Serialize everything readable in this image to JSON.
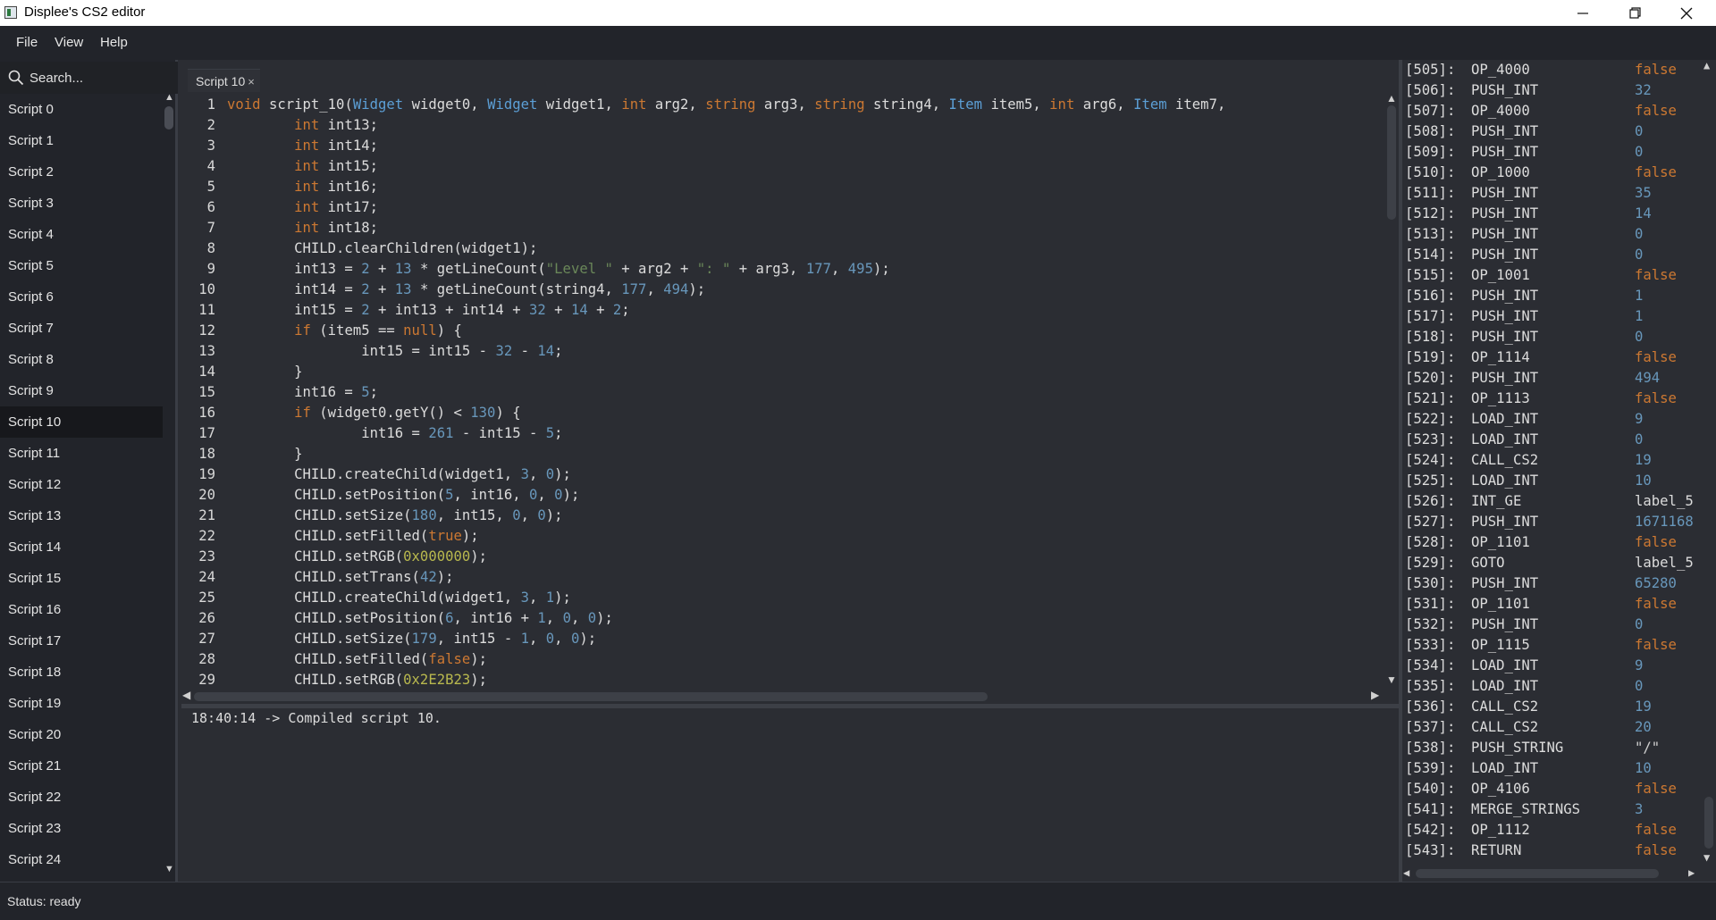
{
  "window": {
    "title": "Displee's CS2 editor"
  },
  "menu": {
    "file": "File",
    "view": "View",
    "help": "Help"
  },
  "sidebar": {
    "search_placeholder": "Search...",
    "active_index": 10,
    "items": [
      "Script 0",
      "Script 1",
      "Script 2",
      "Script 3",
      "Script 4",
      "Script 5",
      "Script 6",
      "Script 7",
      "Script 8",
      "Script 9",
      "Script 10",
      "Script 11",
      "Script 12",
      "Script 13",
      "Script 14",
      "Script 15",
      "Script 16",
      "Script 17",
      "Script 18",
      "Script 19",
      "Script 20",
      "Script 21",
      "Script 22",
      "Script 23",
      "Script 24"
    ]
  },
  "editor": {
    "tab_label": "Script 10",
    "tab_close": "×",
    "lines": [
      [
        [
          "kw",
          "void"
        ],
        [
          "t",
          " script_10("
        ],
        [
          "ty",
          "Widget"
        ],
        [
          "t",
          " widget0, "
        ],
        [
          "ty",
          "Widget"
        ],
        [
          "t",
          " widget1, "
        ],
        [
          "kw",
          "int"
        ],
        [
          "t",
          " arg2, "
        ],
        [
          "kw",
          "string"
        ],
        [
          "t",
          " arg3, "
        ],
        [
          "kw",
          "string"
        ],
        [
          "t",
          " string4, "
        ],
        [
          "ty",
          "Item"
        ],
        [
          "t",
          " item5, "
        ],
        [
          "kw",
          "int"
        ],
        [
          "t",
          " arg6, "
        ],
        [
          "ty",
          "Item"
        ],
        [
          "t",
          " item7,"
        ]
      ],
      [
        [
          "t",
          "        "
        ],
        [
          "kw",
          "int"
        ],
        [
          "t",
          " int13;"
        ]
      ],
      [
        [
          "t",
          "        "
        ],
        [
          "kw",
          "int"
        ],
        [
          "t",
          " int14;"
        ]
      ],
      [
        [
          "t",
          "        "
        ],
        [
          "kw",
          "int"
        ],
        [
          "t",
          " int15;"
        ]
      ],
      [
        [
          "t",
          "        "
        ],
        [
          "kw",
          "int"
        ],
        [
          "t",
          " int16;"
        ]
      ],
      [
        [
          "t",
          "        "
        ],
        [
          "kw",
          "int"
        ],
        [
          "t",
          " int17;"
        ]
      ],
      [
        [
          "t",
          "        "
        ],
        [
          "kw",
          "int"
        ],
        [
          "t",
          " int18;"
        ]
      ],
      [
        [
          "t",
          "        CHILD.clearChildren(widget1);"
        ]
      ],
      [
        [
          "t",
          "        int13 = "
        ],
        [
          "num",
          "2"
        ],
        [
          "t",
          " + "
        ],
        [
          "num",
          "13"
        ],
        [
          "t",
          " * getLineCount("
        ],
        [
          "str",
          "\"Level \""
        ],
        [
          "t",
          " + arg2 + "
        ],
        [
          "str",
          "\": \""
        ],
        [
          "t",
          " + arg3, "
        ],
        [
          "num",
          "177"
        ],
        [
          "t",
          ", "
        ],
        [
          "num",
          "495"
        ],
        [
          "t",
          ");"
        ]
      ],
      [
        [
          "t",
          "        int14 = "
        ],
        [
          "num",
          "2"
        ],
        [
          "t",
          " + "
        ],
        [
          "num",
          "13"
        ],
        [
          "t",
          " * getLineCount(string4, "
        ],
        [
          "num",
          "177"
        ],
        [
          "t",
          ", "
        ],
        [
          "num",
          "494"
        ],
        [
          "t",
          ");"
        ]
      ],
      [
        [
          "t",
          "        int15 = "
        ],
        [
          "num",
          "2"
        ],
        [
          "t",
          " + int13 + int14 + "
        ],
        [
          "num",
          "32"
        ],
        [
          "t",
          " + "
        ],
        [
          "num",
          "14"
        ],
        [
          "t",
          " + "
        ],
        [
          "num",
          "2"
        ],
        [
          "t",
          ";"
        ]
      ],
      [
        [
          "t",
          "        "
        ],
        [
          "kw",
          "if"
        ],
        [
          "t",
          " (item5 == "
        ],
        [
          "lit",
          "null"
        ],
        [
          "t",
          ") {"
        ]
      ],
      [
        [
          "t",
          "                int15 = int15 - "
        ],
        [
          "num",
          "32"
        ],
        [
          "t",
          " - "
        ],
        [
          "num",
          "14"
        ],
        [
          "t",
          ";"
        ]
      ],
      [
        [
          "t",
          "        }"
        ]
      ],
      [
        [
          "t",
          "        int16 = "
        ],
        [
          "num",
          "5"
        ],
        [
          "t",
          ";"
        ]
      ],
      [
        [
          "t",
          "        "
        ],
        [
          "kw",
          "if"
        ],
        [
          "t",
          " (widget0.getY() < "
        ],
        [
          "num",
          "130"
        ],
        [
          "t",
          ") {"
        ]
      ],
      [
        [
          "t",
          "                int16 = "
        ],
        [
          "num",
          "261"
        ],
        [
          "t",
          " - int15 - "
        ],
        [
          "num",
          "5"
        ],
        [
          "t",
          ";"
        ]
      ],
      [
        [
          "t",
          "        }"
        ]
      ],
      [
        [
          "t",
          "        CHILD.createChild(widget1, "
        ],
        [
          "num",
          "3"
        ],
        [
          "t",
          ", "
        ],
        [
          "num",
          "0"
        ],
        [
          "t",
          ");"
        ]
      ],
      [
        [
          "t",
          "        CHILD.setPosition("
        ],
        [
          "num",
          "5"
        ],
        [
          "t",
          ", int16, "
        ],
        [
          "num",
          "0"
        ],
        [
          "t",
          ", "
        ],
        [
          "num",
          "0"
        ],
        [
          "t",
          ");"
        ]
      ],
      [
        [
          "t",
          "        CHILD.setSize("
        ],
        [
          "num",
          "180"
        ],
        [
          "t",
          ", int15, "
        ],
        [
          "num",
          "0"
        ],
        [
          "t",
          ", "
        ],
        [
          "num",
          "0"
        ],
        [
          "t",
          ");"
        ]
      ],
      [
        [
          "t",
          "        CHILD.setFilled("
        ],
        [
          "lit",
          "true"
        ],
        [
          "t",
          ");"
        ]
      ],
      [
        [
          "t",
          "        CHILD.setRGB("
        ],
        [
          "hex",
          "0x000000"
        ],
        [
          "t",
          ");"
        ]
      ],
      [
        [
          "t",
          "        CHILD.setTrans("
        ],
        [
          "num",
          "42"
        ],
        [
          "t",
          ");"
        ]
      ],
      [
        [
          "t",
          "        CHILD.createChild(widget1, "
        ],
        [
          "num",
          "3"
        ],
        [
          "t",
          ", "
        ],
        [
          "num",
          "1"
        ],
        [
          "t",
          ");"
        ]
      ],
      [
        [
          "t",
          "        CHILD.setPosition("
        ],
        [
          "num",
          "6"
        ],
        [
          "t",
          ", int16 + "
        ],
        [
          "num",
          "1"
        ],
        [
          "t",
          ", "
        ],
        [
          "num",
          "0"
        ],
        [
          "t",
          ", "
        ],
        [
          "num",
          "0"
        ],
        [
          "t",
          ");"
        ]
      ],
      [
        [
          "t",
          "        CHILD.setSize("
        ],
        [
          "num",
          "179"
        ],
        [
          "t",
          ", int15 - "
        ],
        [
          "num",
          "1"
        ],
        [
          "t",
          ", "
        ],
        [
          "num",
          "0"
        ],
        [
          "t",
          ", "
        ],
        [
          "num",
          "0"
        ],
        [
          "t",
          ");"
        ]
      ],
      [
        [
          "t",
          "        CHILD.setFilled("
        ],
        [
          "lit",
          "false"
        ],
        [
          "t",
          ");"
        ]
      ],
      [
        [
          "t",
          "        CHILD.setRGB("
        ],
        [
          "hex",
          "0x2E2B23"
        ],
        [
          "t",
          ");"
        ]
      ]
    ]
  },
  "console": {
    "message": "18:40:14 -> Compiled script 10."
  },
  "instructions": [
    [
      "[505]:",
      "OP_4000",
      "false",
      "bool"
    ],
    [
      "[506]:",
      "PUSH_INT",
      "32",
      "number"
    ],
    [
      "[507]:",
      "OP_4000",
      "false",
      "bool"
    ],
    [
      "[508]:",
      "PUSH_INT",
      "0",
      "number"
    ],
    [
      "[509]:",
      "PUSH_INT",
      "0",
      "number"
    ],
    [
      "[510]:",
      "OP_1000",
      "false",
      "bool"
    ],
    [
      "[511]:",
      "PUSH_INT",
      "35",
      "number"
    ],
    [
      "[512]:",
      "PUSH_INT",
      "14",
      "number"
    ],
    [
      "[513]:",
      "PUSH_INT",
      "0",
      "number"
    ],
    [
      "[514]:",
      "PUSH_INT",
      "0",
      "number"
    ],
    [
      "[515]:",
      "OP_1001",
      "false",
      "bool"
    ],
    [
      "[516]:",
      "PUSH_INT",
      "1",
      "number"
    ],
    [
      "[517]:",
      "PUSH_INT",
      "1",
      "number"
    ],
    [
      "[518]:",
      "PUSH_INT",
      "0",
      "number"
    ],
    [
      "[519]:",
      "OP_1114",
      "false",
      "bool"
    ],
    [
      "[520]:",
      "PUSH_INT",
      "494",
      "number"
    ],
    [
      "[521]:",
      "OP_1113",
      "false",
      "bool"
    ],
    [
      "[522]:",
      "LOAD_INT",
      "9",
      "number"
    ],
    [
      "[523]:",
      "LOAD_INT",
      "0",
      "number"
    ],
    [
      "[524]:",
      "CALL_CS2",
      "19",
      "number"
    ],
    [
      "[525]:",
      "LOAD_INT",
      "10",
      "number"
    ],
    [
      "[526]:",
      "INT_GE",
      "label_5",
      "label"
    ],
    [
      "[527]:",
      "PUSH_INT",
      "1671168",
      "number"
    ],
    [
      "[528]:",
      "OP_1101",
      "false",
      "bool"
    ],
    [
      "[529]:",
      "GOTO",
      "label_5",
      "label"
    ],
    [
      "[530]:",
      "PUSH_INT",
      "65280",
      "number"
    ],
    [
      "[531]:",
      "OP_1101",
      "false",
      "bool"
    ],
    [
      "[532]:",
      "PUSH_INT",
      "0",
      "number"
    ],
    [
      "[533]:",
      "OP_1115",
      "false",
      "bool"
    ],
    [
      "[534]:",
      "LOAD_INT",
      "9",
      "number"
    ],
    [
      "[535]:",
      "LOAD_INT",
      "0",
      "number"
    ],
    [
      "[536]:",
      "CALL_CS2",
      "19",
      "number"
    ],
    [
      "[537]:",
      "CALL_CS2",
      "20",
      "number"
    ],
    [
      "[538]:",
      "PUSH_STRING",
      "\"/\"",
      "string"
    ],
    [
      "[539]:",
      "LOAD_INT",
      "10",
      "number"
    ],
    [
      "[540]:",
      "OP_4106",
      "false",
      "bool"
    ],
    [
      "[541]:",
      "MERGE_STRINGS",
      "3",
      "number"
    ],
    [
      "[542]:",
      "OP_1112",
      "false",
      "bool"
    ],
    [
      "[543]:",
      "RETURN",
      "false",
      "bool"
    ]
  ],
  "status": {
    "text": "Status: ready"
  }
}
